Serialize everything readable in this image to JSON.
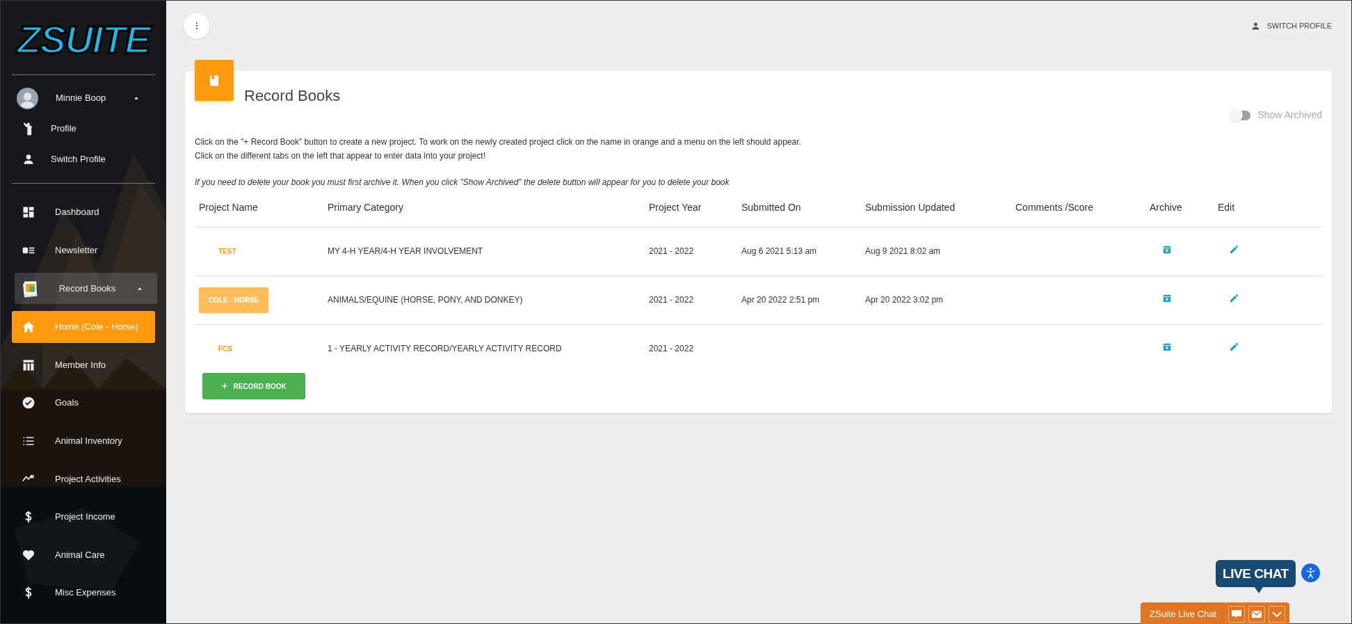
{
  "sidebar": {
    "logo": "ZSUITE",
    "user": {
      "name": "Minnie Boop",
      "expanded": true,
      "menu": [
        {
          "label": "Profile"
        },
        {
          "label": "Switch Profile"
        }
      ]
    },
    "nav": [
      {
        "label": "Dashboard"
      },
      {
        "label": "Newsletter"
      }
    ],
    "record_books": {
      "label": "Record Books",
      "expanded": true,
      "children": [
        {
          "label": "Home (Cole - Horse)",
          "selected": true
        },
        {
          "label": "Member Info",
          "selected": false
        },
        {
          "label": "Goals",
          "selected": false
        },
        {
          "label": "Animal Inventory",
          "selected": false
        },
        {
          "label": "Project Activities",
          "selected": false
        },
        {
          "label": "Project Income",
          "selected": false
        },
        {
          "label": "Animal Care",
          "selected": false
        },
        {
          "label": "Misc Expenses",
          "selected": false
        }
      ]
    }
  },
  "topbar": {
    "switch_profile": "SWITCH PROFILE"
  },
  "card": {
    "title": "Record Books",
    "show_archived": {
      "label": "Show Archived",
      "on": false
    },
    "instructions": [
      "Click on the \"+ Record Book\" button to create a new project. To work on the newly created project click on the name in orange and a menu on the left should appear.",
      "Click on the different tabs on the left that appear to enter data into your project!"
    ],
    "note": "If you need to delete your book you must first archive it. When you click \"Show Archived\" the delete button will appear for you to delete your book",
    "table": {
      "columns": [
        "Project Name",
        "Primary Category",
        "Project Year",
        "Submitted On",
        "Submission Updated",
        "Comments /Score",
        "Archive",
        "Edit"
      ],
      "rows": [
        {
          "name": "TEST",
          "selected": false,
          "category": "MY 4-H YEAR/4-H YEAR INVOLVEMENT",
          "year": "2021 - 2022",
          "submitted": "Aug 6 2021 5:13 am",
          "updated": "Aug 9 2021 8:02 am"
        },
        {
          "name": "COLE - HORSE",
          "selected": true,
          "category": "ANIMALS/EQUINE (HORSE, PONY, AND DONKEY)",
          "year": "2021 - 2022",
          "submitted": "Apr 20 2022 2:51 pm",
          "updated": "Apr 20 2022 3:02 pm"
        },
        {
          "name": "FCS",
          "selected": false,
          "category": "1 - YEARLY ACTIVITY RECORD/YEARLY ACTIVITY RECORD",
          "year": "2021 - 2022"
        }
      ]
    },
    "add_button": "RECORD BOOK",
    "add_symbol": "+"
  },
  "live_chat": {
    "bubble": "LIVE CHAT",
    "bar": "ZSuite Live Chat"
  }
}
